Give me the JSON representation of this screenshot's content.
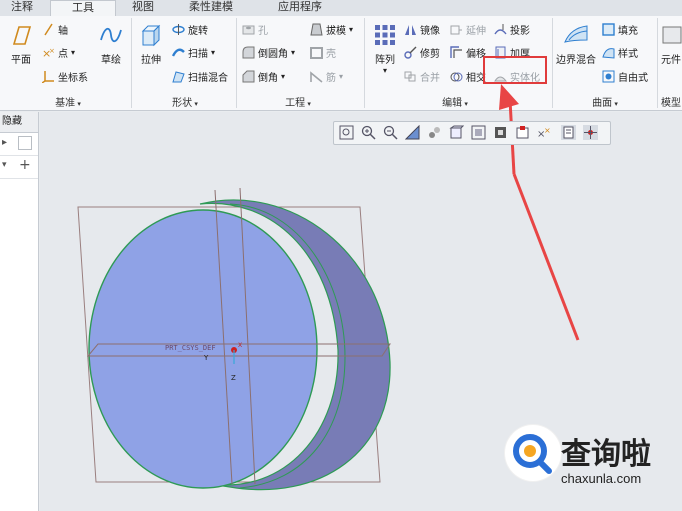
{
  "tabs": [
    "注释",
    "工具",
    "视图",
    "柔性建模",
    "应用程序"
  ],
  "selected_tab": "工具",
  "groups": {
    "datum": {
      "label": "基准",
      "plane": "平面",
      "axis": "轴",
      "point": "点",
      "csys": "坐标系",
      "sketch": "草绘"
    },
    "shapes": {
      "label": "形状",
      "extrude": "拉伸",
      "revolve": "旋转",
      "sweep": "扫描",
      "swept_blend": "扫描混合"
    },
    "engineering": {
      "label": "工程",
      "hole": "孔",
      "round": "倒圆角",
      "chamfer": "倒角",
      "draft": "拔模",
      "shell": "壳",
      "rib": "筋"
    },
    "editing": {
      "label": "编辑",
      "pattern": "阵列",
      "mirror": "镜像",
      "trim": "修剪",
      "merge": "合并",
      "extend": "延伸",
      "offset": "偏移",
      "intersect": "相交",
      "project": "投影",
      "thicken": "加厚",
      "solidify": "实体化"
    },
    "surfaces": {
      "label": "曲面",
      "boundary_blend": "边界混合",
      "fill": "填充",
      "style": "样式",
      "freestyle": "自由式"
    },
    "model_intent": {
      "label": "模型",
      "component_interface": "元件"
    }
  },
  "left_panel": {
    "tab": "隐藏"
  },
  "model": {
    "csys_label": "PRT_CSYS_DEF",
    "axis_y": "Y",
    "axis_z": "Z",
    "axis_x": "X"
  },
  "watermark": {
    "brand": "查询啦",
    "domain": "chaxunla.com"
  },
  "colors": {
    "disk_face": "#8fa2e6",
    "disk_rim": "#7b7fb8",
    "highlight": "#e03b3b",
    "arrow": "#e84545"
  }
}
